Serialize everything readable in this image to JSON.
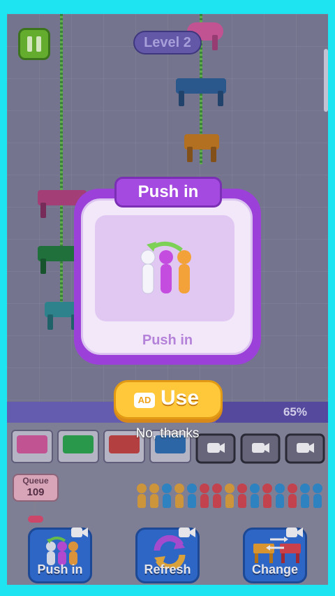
{
  "hud": {
    "level_label": "Level 2",
    "pause_icon": "pause-icon"
  },
  "popup": {
    "title": "Push in",
    "caption": "Push in",
    "illustration_icon": "push-in-illustration",
    "use_button": {
      "ad_badge": "AD",
      "label": "Use"
    },
    "dismiss_label": "No, thanks"
  },
  "progress": {
    "percent_label": "65%",
    "fraction": 0.65
  },
  "queue": {
    "label": "Queue",
    "count": "109"
  },
  "boosters": [
    {
      "label": "Push in",
      "icon": "push-in-icon",
      "ad_icon": "video-ad-icon"
    },
    {
      "label": "Refresh",
      "icon": "refresh-icon",
      "ad_icon": "video-ad-icon"
    },
    {
      "label": "Change",
      "icon": "change-tables-icon",
      "ad_icon": "video-ad-icon"
    }
  ],
  "colors": {
    "background": "#807f99",
    "border": "#1de4f0",
    "modal_frame": "#9b40d8",
    "use_button": "#ffc83a",
    "booster_button": "#2f6fd6"
  }
}
